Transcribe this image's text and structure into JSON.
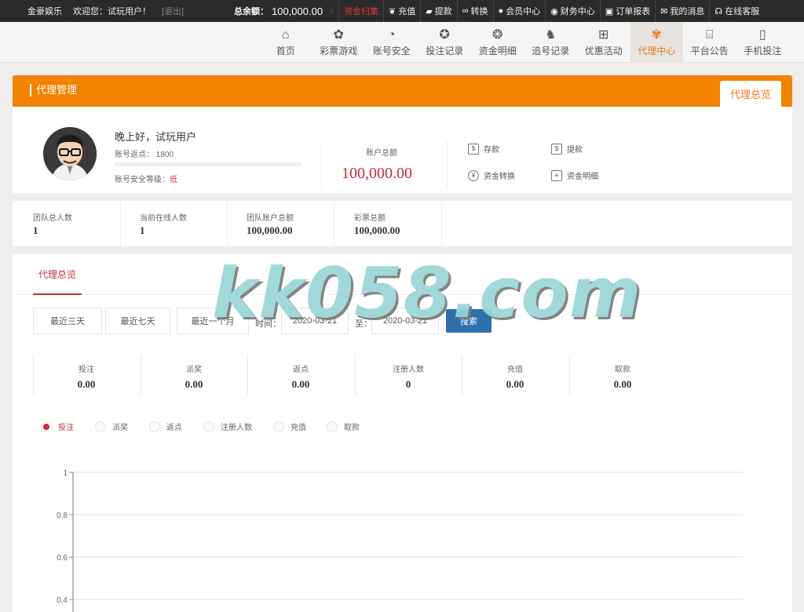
{
  "topbar": {
    "brand": "金豪娱乐",
    "welcome": "欢迎您：试玩用户！",
    "logout": "[退出]",
    "balance_label": "总余额：",
    "balance_value": "100,000.00",
    "nav": [
      {
        "label": "资金归集",
        "icon": "none",
        "highlight": true
      },
      {
        "label": "充值",
        "icon": "money-bag-icon"
      },
      {
        "label": "提款",
        "icon": "wallet-icon"
      },
      {
        "label": "转换",
        "icon": "exchange-icon"
      },
      {
        "label": "会员中心",
        "icon": "user-icon"
      },
      {
        "label": "财务中心",
        "icon": "finance-icon"
      },
      {
        "label": "订单报表",
        "icon": "report-icon"
      },
      {
        "label": "我的消息",
        "icon": "mail-icon"
      },
      {
        "label": "在线客服",
        "icon": "headset-icon"
      }
    ]
  },
  "mainnav": {
    "items": [
      {
        "label": "首页",
        "icon": "home-icon"
      },
      {
        "label": "彩票游戏",
        "icon": "lottery-icon"
      },
      {
        "label": "账号安全",
        "icon": "security-icon"
      },
      {
        "label": "投注记录",
        "icon": "bet-record-icon"
      },
      {
        "label": "资金明细",
        "icon": "fund-detail-icon"
      },
      {
        "label": "追号记录",
        "icon": "chase-record-icon"
      },
      {
        "label": "优惠活动",
        "icon": "gift-icon"
      },
      {
        "label": "代理中心",
        "icon": "agent-icon",
        "active": true
      },
      {
        "label": "平台公告",
        "icon": "announcement-icon"
      },
      {
        "label": "手机投注",
        "icon": "mobile-icon"
      }
    ]
  },
  "panel": {
    "title": "代理管理",
    "tab": "代理总览"
  },
  "user": {
    "greeting": "晚上好，试玩用户",
    "rebate_label": "账号返点：",
    "rebate_value": "1800",
    "security_label": "账号安全等级：",
    "security_value": "低",
    "total_label": "账户总额",
    "total_value": "100,000.00"
  },
  "quick_actions": [
    {
      "label": "存款",
      "icon": "deposit-icon"
    },
    {
      "label": "提款",
      "icon": "withdraw-icon"
    },
    {
      "label": "资金转换",
      "icon": "transfer-icon"
    },
    {
      "label": "资金明细",
      "icon": "detail-icon"
    }
  ],
  "team_stats": [
    {
      "label": "团队总人数",
      "value": "1"
    },
    {
      "label": "当前在线人数",
      "value": "1"
    },
    {
      "label": "团队账户总额",
      "value": "100,000.00"
    },
    {
      "label": "彩票总额",
      "value": "100,000.00"
    }
  ],
  "overview": {
    "tab": "代理总览",
    "buttons": [
      "最近三天",
      "最近七天",
      "最近一个月"
    ],
    "time_label": "时间：",
    "start_date": "2020-03-21",
    "to_label": "至：",
    "end_date": "2020-03-21",
    "search": "搜索"
  },
  "summary": [
    {
      "label": "投注",
      "value": "0.00"
    },
    {
      "label": "派奖",
      "value": "0.00"
    },
    {
      "label": "返点",
      "value": "0.00"
    },
    {
      "label": "注册人数",
      "value": "0"
    },
    {
      "label": "充值",
      "value": "0.00"
    },
    {
      "label": "取款",
      "value": "0.00"
    }
  ],
  "radios": [
    {
      "label": "投注",
      "checked": true
    },
    {
      "label": "派奖"
    },
    {
      "label": "返点"
    },
    {
      "label": "注册人数"
    },
    {
      "label": "充值"
    },
    {
      "label": "取款"
    }
  ],
  "chart_data": {
    "type": "line",
    "series": [
      {
        "values": []
      }
    ],
    "yticks": [
      "1",
      "0.8",
      "0.6",
      "0.4"
    ],
    "ylim": [
      0,
      1
    ],
    "grid": true
  },
  "watermark": "kk058.com",
  "colors": {
    "accent": "#f08300",
    "active_nav": "#ee7b1d",
    "highlight_red": "#c0303c",
    "search_blue": "#2f6faa"
  }
}
